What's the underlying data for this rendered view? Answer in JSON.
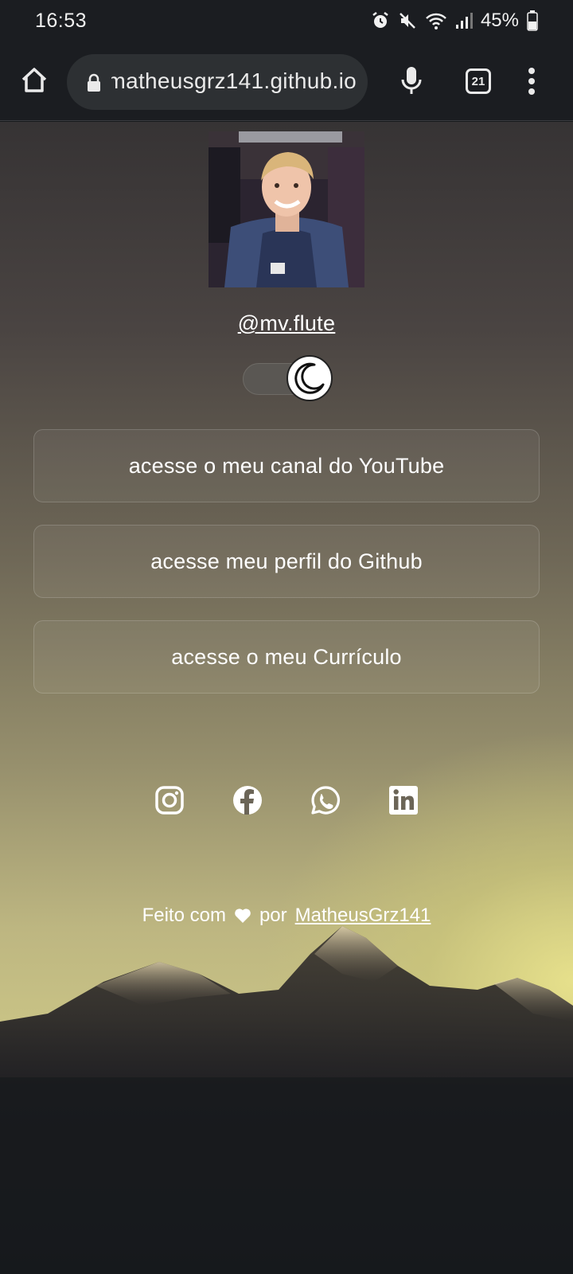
{
  "status_bar": {
    "time": "16:53",
    "battery": "45%",
    "icons": [
      "alarm-icon",
      "mute-icon",
      "wifi-icon",
      "signal-icon",
      "battery-icon"
    ]
  },
  "browser": {
    "url": "matheusgrz141.github.io",
    "tab_count": "21",
    "icons": [
      "home-icon",
      "lock-icon",
      "mic-icon",
      "tabs-icon",
      "more-vert-icon"
    ]
  },
  "profile": {
    "handle": "@mv.flute"
  },
  "theme_toggle": {
    "mode": "dark",
    "icon": "moon-icon"
  },
  "links": [
    {
      "label": "acesse o meu canal do YouTube"
    },
    {
      "label": "acesse meu perfil do Github"
    },
    {
      "label": "acesse o meu Currículo"
    }
  ],
  "social": [
    "instagram-icon",
    "facebook-icon",
    "whatsapp-icon",
    "linkedin-icon"
  ],
  "footer": {
    "prefix": "Feito com",
    "heart_icon": "heart-icon",
    "middle": "por",
    "author": "MatheusGrz141"
  },
  "colors": {
    "chrome_bg": "#1b1d21",
    "url_pill": "#2d3033",
    "text": "#ffffff"
  }
}
